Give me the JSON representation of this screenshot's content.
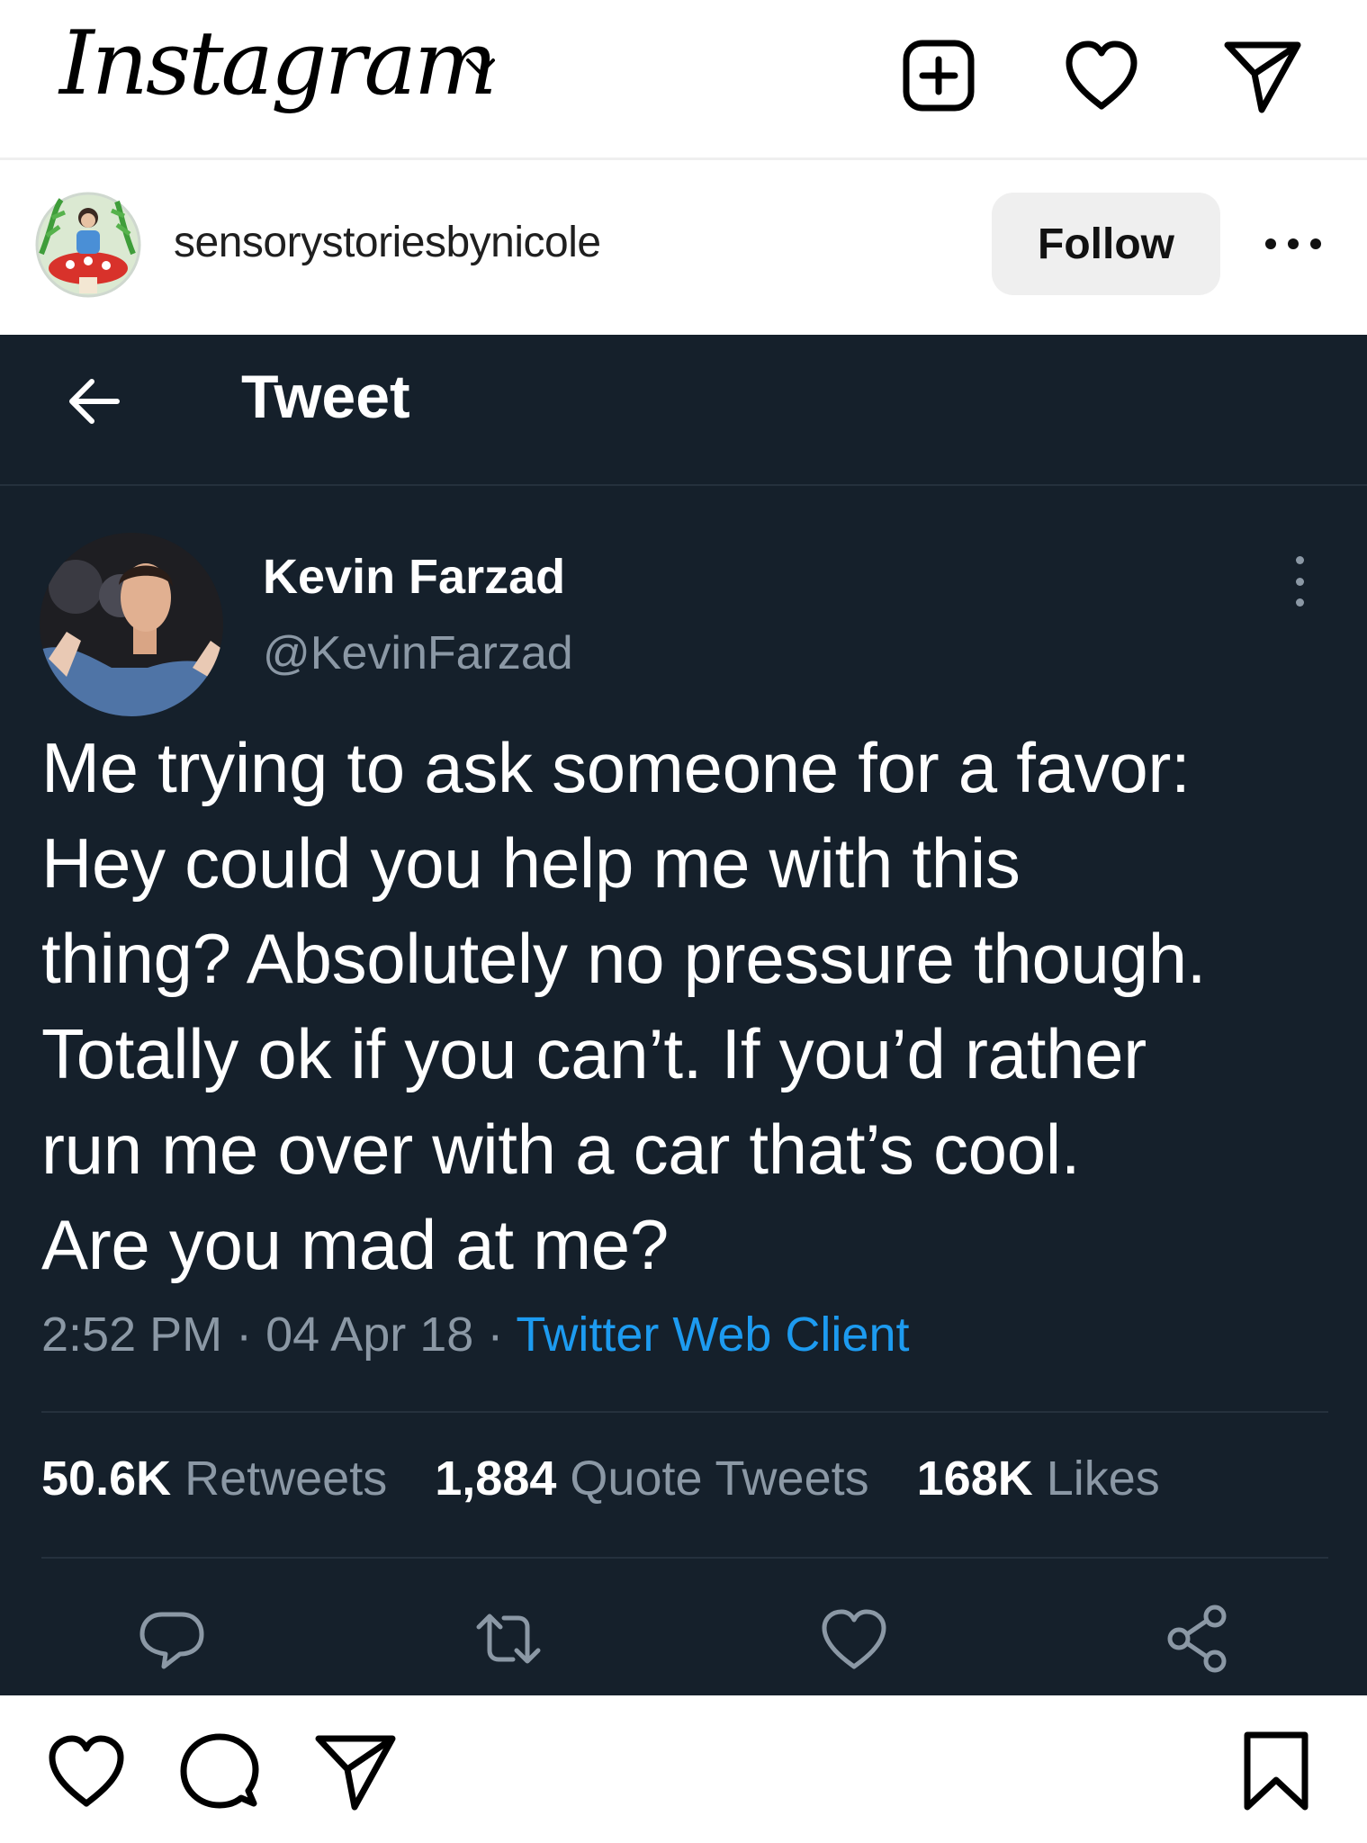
{
  "app": {
    "logo_text": "Instagram"
  },
  "top_bar": {
    "icons": [
      "new-post-icon",
      "heart-icon",
      "direct-message-icon"
    ]
  },
  "post": {
    "username": "sensorystoriesbynicole",
    "follow_label": "Follow"
  },
  "tweet": {
    "header_title": "Tweet",
    "author_name": "Kevin Farzad",
    "author_handle": "@KevinFarzad",
    "text_lines": [
      "Me trying to ask someone for a favor:",
      "Hey could you help me with this",
      "thing? Absolutely no pressure though.",
      "Totally ok if you can’t. If you’d rather",
      "run me over with a car that’s cool.",
      "Are you mad at me?"
    ],
    "time": "2:52 PM",
    "date": "04 Apr 18",
    "client": "Twitter Web Client",
    "dot": "·",
    "retweets_count": "50.6K",
    "retweets_label": "Retweets",
    "quotes_count": "1,884",
    "quotes_label": "Quote Tweets",
    "likes_count": "168K",
    "likes_label": "Likes",
    "colors": {
      "background": "#15202b",
      "link": "#1d9bf0",
      "secondary_text": "#8b98a5"
    }
  },
  "bottom_bar": {
    "icons": [
      "heart-icon",
      "comment-icon",
      "share-icon",
      "bookmark-icon"
    ]
  }
}
